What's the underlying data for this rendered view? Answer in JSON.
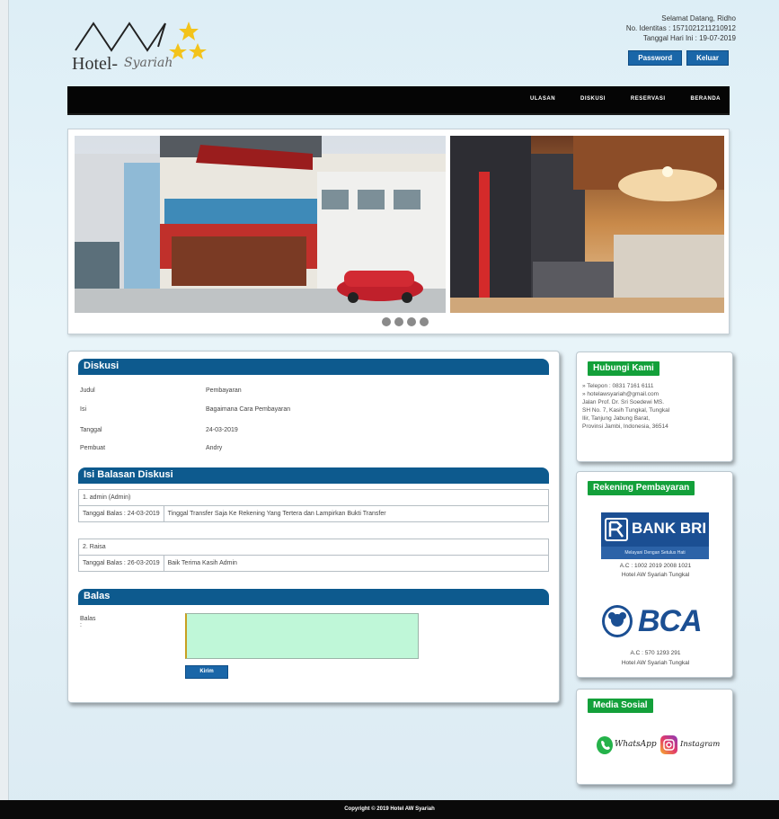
{
  "header": {
    "logo_text": "Hotel-",
    "logo_script": "Syariah",
    "greeting": "Selamat Datang, Ridho",
    "id_line": "No. Identitas : 1571021211210912",
    "date_line": "Tanggal Hari Ini : 19-07-2019",
    "password_label": "Password",
    "logout_label": "Keluar"
  },
  "nav": [
    "ULASAN",
    "DISKUSI",
    "RESERVASI",
    "BERANDA"
  ],
  "diskusi": {
    "title": "Diskusi",
    "rows": [
      {
        "label": "Judul",
        "value": "Pembayaran"
      },
      {
        "label": "Isi",
        "value": "Bagaimana Cara Pembayaran"
      },
      {
        "label": "Tanggal",
        "value": "24-03-2019"
      },
      {
        "label": "Pembuat",
        "value": "Andry"
      }
    ]
  },
  "balasan": {
    "title": "Isi Balasan Diskusi",
    "items": [
      {
        "header": "1. admin (Admin)",
        "date": "Tanggal Balas : 24-03-2019",
        "text": "Tinggal Transfer Saja Ke Rekening Yang Tertera dan Lampirkan Bukti Transfer"
      },
      {
        "header": "2. Raisa",
        "date": "Tanggal Balas : 26-03-2019",
        "text": "Baik Terima Kasih Admin"
      }
    ]
  },
  "balas": {
    "title": "Balas",
    "label": "Balas :",
    "submit": "Kirim"
  },
  "hubungi": {
    "title": "Hubungi Kami",
    "lines": [
      "» Telepon : 0831 7161 6111",
      "» hotelawsyariah@gmail.com",
      "Jalan Prof. Dr. Sri Soedewi MS.",
      "SH No. 7, Kasih Tungkal, Tungkal",
      "Ilir, Tanjung Jabung Barat,",
      "Provinsi Jambi, Indonesia, 36514"
    ]
  },
  "rekening": {
    "title": "Rekening Pembayaran",
    "bri_name": "BANK BRI",
    "bri_tagline": "Melayani Dengan Setulus Hati",
    "bri_account": "A.C : 1002 2019 2008 1021",
    "bri_holder": "Hotel AW Syariah Tungkal",
    "bca_name": "BCA",
    "bca_account": "A.C : 570 1293 291",
    "bca_holder": "Hotel AW Syariah Tungkal"
  },
  "sosial": {
    "title": "Media Sosial",
    "whatsapp": "WhatsApp",
    "instagram": "Instagram"
  },
  "footer": "Copyright © 2019 Hotel AW Syariah",
  "colors": {
    "nav": "#050505",
    "section_head": "#0d5a8e",
    "widget_head": "#13a03a",
    "button": "#1a66a8",
    "textarea": "#bff7d8"
  }
}
